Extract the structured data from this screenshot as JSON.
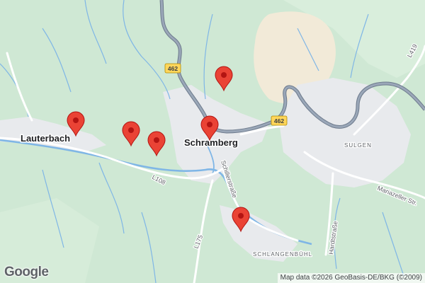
{
  "map": {
    "places": {
      "lauterbach": "Lauterbach",
      "schramberg": "Schramberg",
      "sulgen": "SULGEN",
      "schlangenbuhl": "SCHLANGENBÜHL"
    },
    "streets": {
      "schillerstrasse": "Schillerstraße",
      "mariazeller": "Mariazeller Str.",
      "hardtstrasse": "Hardtstraße",
      "l108": "L108",
      "l175": "L175",
      "l419": "L419"
    },
    "road_shields": {
      "b462_north": "462",
      "b462_east": "462"
    },
    "markers": [
      {
        "name": "marker-1"
      },
      {
        "name": "marker-2"
      },
      {
        "name": "marker-3"
      },
      {
        "name": "marker-4"
      },
      {
        "name": "marker-5"
      },
      {
        "name": "marker-6"
      }
    ],
    "colors": {
      "forest": "#cfe8d4",
      "forest_dark": "#bfe0c6",
      "field": "#f2ead8",
      "urban": "#e8eaed",
      "water": "#7fb6e6",
      "highway": "#8e9bad",
      "marker": "#ea4335",
      "marker_dot": "#b31412"
    }
  },
  "footer": {
    "logo": "Google",
    "attribution": "Map data ©2026 GeoBasis-DE/BKG (©2009)"
  }
}
